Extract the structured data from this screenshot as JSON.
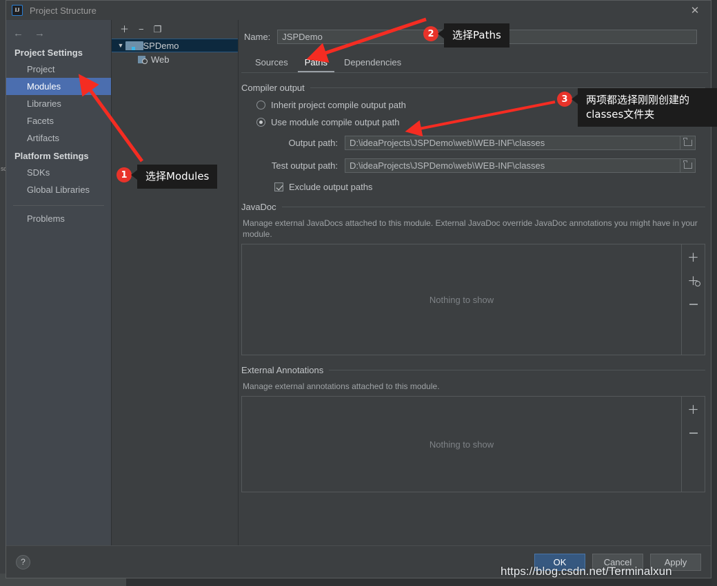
{
  "window": {
    "title": "Project Structure",
    "app_icon": "IJ",
    "close_icon": "✕"
  },
  "sidebar": {
    "nav": {
      "back_icon": "←",
      "forward_icon": "→"
    },
    "groups": [
      {
        "label": "Project Settings",
        "items": [
          {
            "label": "Project",
            "selected": false
          },
          {
            "label": "Modules",
            "selected": true
          },
          {
            "label": "Libraries",
            "selected": false
          },
          {
            "label": "Facets",
            "selected": false
          },
          {
            "label": "Artifacts",
            "selected": false
          }
        ]
      },
      {
        "label": "Platform Settings",
        "items": [
          {
            "label": "SDKs",
            "selected": false
          },
          {
            "label": "Global Libraries",
            "selected": false
          }
        ]
      }
    ],
    "extra_items": [
      {
        "label": "Problems",
        "selected": false
      }
    ]
  },
  "tree_panel": {
    "toolbar": [
      {
        "name": "add-module-button",
        "glyph": "＋"
      },
      {
        "name": "remove-module-button",
        "glyph": "−"
      },
      {
        "name": "copy-module-button",
        "glyph": "❐"
      }
    ],
    "nodes": [
      {
        "label": "JSPDemo",
        "icon": "module-folder-icon",
        "expander": "▼",
        "selected": true,
        "depth": 0
      },
      {
        "label": "Web",
        "icon": "web-facet-icon",
        "expander": "",
        "selected": false,
        "depth": 1
      }
    ]
  },
  "main": {
    "name_label": "Name:",
    "name_value": "JSPDemo",
    "tabs": [
      {
        "label": "Sources",
        "active": false
      },
      {
        "label": "Paths",
        "active": true
      },
      {
        "label": "Dependencies",
        "active": false
      }
    ],
    "compiler_output": {
      "title": "Compiler output",
      "radio_inherit": "Inherit project compile output path",
      "radio_module": "Use module compile output path",
      "radio_selected": "module",
      "output_path_label": "Output path:",
      "output_path_value": "D:\\ideaProjects\\JSPDemo\\web\\WEB-INF\\classes",
      "test_output_path_label": "Test output path:",
      "test_output_path_value": "D:\\ideaProjects\\JSPDemo\\web\\WEB-INF\\classes",
      "exclude_label": "Exclude output paths",
      "exclude_checked": true,
      "browse_icon": "folder-icon"
    },
    "javadoc": {
      "title": "JavaDoc",
      "description": "Manage external JavaDocs attached to this module. External JavaDoc override JavaDoc annotations you might have in your module.",
      "empty_text": "Nothing to show",
      "actions": [
        {
          "name": "add-javadoc-button",
          "glyph": "＋"
        },
        {
          "name": "add-javadoc-url-button",
          "glyph": "＋"
        },
        {
          "name": "remove-javadoc-button",
          "glyph": "−"
        }
      ]
    },
    "external_annotations": {
      "title": "External Annotations",
      "description": "Manage external annotations attached to this module.",
      "empty_text": "Nothing to show",
      "actions": [
        {
          "name": "add-annotation-button",
          "glyph": "＋"
        },
        {
          "name": "remove-annotation-button",
          "glyph": "−"
        }
      ]
    }
  },
  "footer": {
    "help_icon": "?",
    "buttons": [
      {
        "label": "OK",
        "primary": true
      },
      {
        "label": "Cancel",
        "primary": false
      },
      {
        "label": "Apply",
        "primary": false
      }
    ]
  },
  "annotations": {
    "callout_1": {
      "number": "1",
      "text": "选择Modules"
    },
    "callout_2": {
      "number": "2",
      "text": "选择Paths"
    },
    "callout_3": {
      "number": "3",
      "text": "两项都选择刚刚创建的\nclasses文件夹"
    },
    "arrow_color": "#f52c22",
    "badge_color": "#e8332a",
    "watermark": "https://blog.csdn.net/Terminalxun"
  },
  "backdrop": {
    "strip_text": "sc"
  }
}
